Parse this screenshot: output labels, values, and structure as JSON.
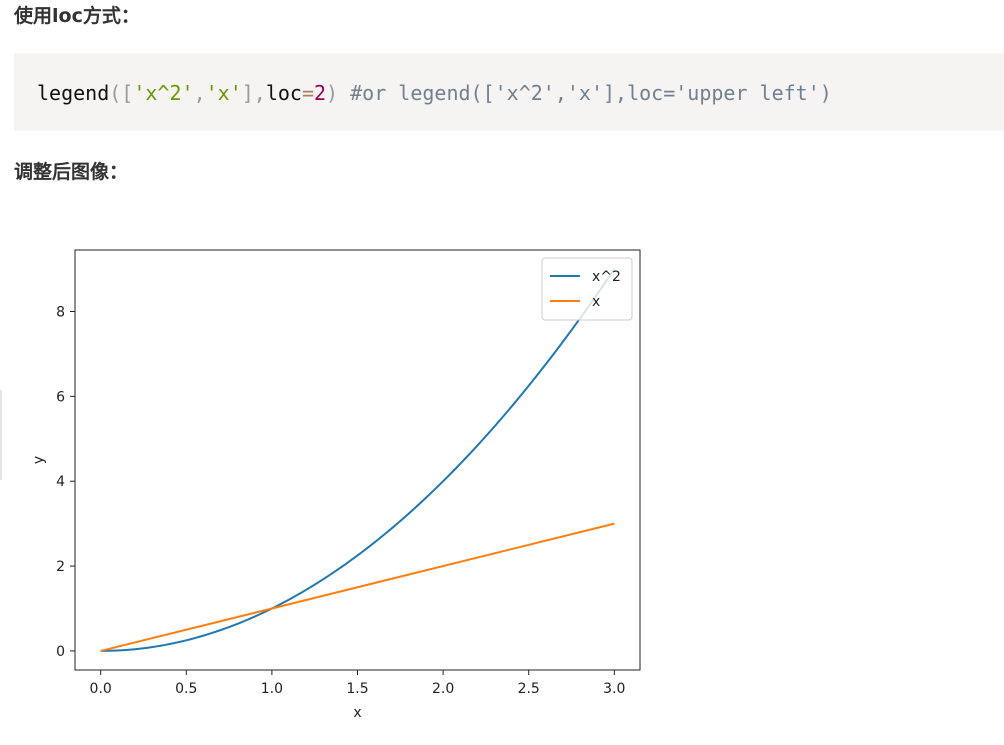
{
  "headings": {
    "first": "使用loc方式：",
    "second": "调整后图像："
  },
  "code": {
    "tokens": [
      {
        "text": "legend",
        "kind": "fn"
      },
      {
        "text": "([",
        "kind": "punc"
      },
      {
        "text": "'x^2'",
        "kind": "str"
      },
      {
        "text": ",",
        "kind": "punc"
      },
      {
        "text": "'x'",
        "kind": "str"
      },
      {
        "text": "],",
        "kind": "punc"
      },
      {
        "text": "loc",
        "kind": "name"
      },
      {
        "text": "=",
        "kind": "op"
      },
      {
        "text": "2",
        "kind": "num"
      },
      {
        "text": ") ",
        "kind": "punc"
      },
      {
        "text": "#or legend(['x^2','x'],loc='upper left')",
        "kind": "cmt"
      }
    ]
  },
  "colors": {
    "series_1": "#1f77b4",
    "series_2": "#ff7f0e",
    "code_bg": "#f6f4f2"
  },
  "chart_data": {
    "type": "line",
    "title": "",
    "xlabel": "x",
    "ylabel": "y",
    "xlim": [
      -0.15,
      3.15
    ],
    "ylim": [
      -0.45,
      9.45
    ],
    "xticks": [
      "0.0",
      "0.5",
      "1.0",
      "1.5",
      "2.0",
      "2.5",
      "3.0"
    ],
    "yticks": [
      "0",
      "2",
      "4",
      "6",
      "8"
    ],
    "grid": false,
    "legend_position": "upper right",
    "series": [
      {
        "name": "x^2",
        "x": [
          0.0,
          0.25,
          0.5,
          0.75,
          1.0,
          1.25,
          1.5,
          1.75,
          2.0,
          2.25,
          2.5,
          2.75,
          3.0
        ],
        "y": [
          0.0,
          0.0625,
          0.25,
          0.5625,
          1.0,
          1.5625,
          2.25,
          3.0625,
          4.0,
          5.0625,
          6.25,
          7.5625,
          9.0
        ]
      },
      {
        "name": "x",
        "x": [
          0.0,
          3.0
        ],
        "y": [
          0.0,
          3.0
        ]
      }
    ]
  }
}
